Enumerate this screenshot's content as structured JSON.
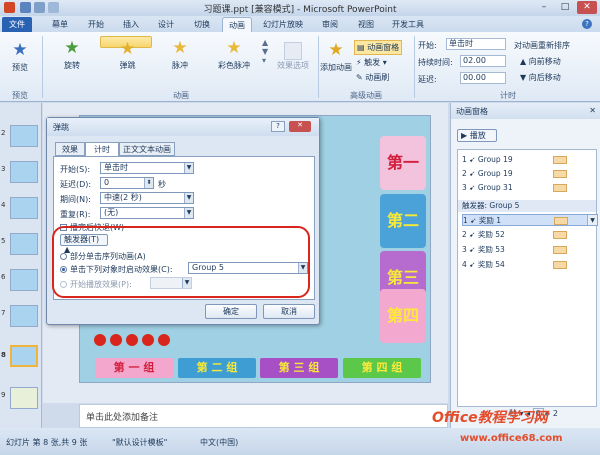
{
  "window": {
    "title": "习题课.ppt [兼容模式] - Microsoft PowerPoint"
  },
  "tabs": [
    "文件",
    "幕单",
    "开始",
    "插入",
    "设计",
    "切换",
    "动画",
    "幻灯片放映",
    "审阅",
    "视图",
    "开发工具"
  ],
  "ribbon": {
    "preview": "预览",
    "preview_group": "预览",
    "effects": [
      "旋转",
      "弹跳",
      "脉冲",
      "彩色脉冲"
    ],
    "effect_options": "效果选项",
    "anim_group": "动画",
    "add_anim": "添加动画",
    "anim_pane": "动画窗格",
    "trigger": "触发",
    "anim_brush": "动画刷",
    "adv_group": "高级动画",
    "start_label": "开始:",
    "start_value": "单击时",
    "duration_label": "持续时间:",
    "duration_value": "02.00",
    "delay_label": "延迟:",
    "delay_value": "00.00",
    "reorder": "对动画重新排序",
    "forward": "向前移动",
    "backward": "向后移动",
    "timing_group": "计时"
  },
  "slides": {
    "numbers": [
      "2",
      "3",
      "4",
      "5",
      "6",
      "7",
      "8",
      "9"
    ],
    "active": "8"
  },
  "slide": {
    "banners": [
      "第一关",
      "第二关",
      "第三关",
      "第四关"
    ],
    "groups": [
      "第 一 组",
      "第 二 组",
      "第 三 组",
      "第 四 组"
    ]
  },
  "notes": "单击此处添加备注",
  "anim_pane": {
    "title": "动画窗格",
    "play": "播放",
    "items": [
      {
        "n": "1",
        "name": "Group 19"
      },
      {
        "n": "2",
        "name": "Group 19"
      },
      {
        "n": "3",
        "name": "Group 31"
      }
    ],
    "trigger_label": "触发器: Group 5",
    "trigger_items": [
      {
        "n": "1",
        "name": "奖励 1"
      },
      {
        "n": "2",
        "name": "奖励 52"
      },
      {
        "n": "3",
        "name": "奖励 53"
      },
      {
        "n": "4",
        "name": "奖励 54"
      }
    ],
    "seconds": "秒",
    "page_from": "0",
    "page_to": "2"
  },
  "dialog": {
    "title": "弹跳",
    "tabs": [
      "效果",
      "计时",
      "正文文本动画"
    ],
    "start_label": "开始(S):",
    "start_value": "单击时",
    "delay_label": "延迟(D):",
    "delay_value": "0",
    "delay_unit": "秒",
    "duration_label": "期间(N):",
    "duration_value": "中速(2 秒)",
    "repeat_label": "重复(R):",
    "repeat_value": "(无)",
    "rewind": "播完后快退(W)",
    "triggers_button": "触发器(T)",
    "opt1": "部分单击序列动画(A)",
    "opt2": "单击下列对象时启动效果(C):",
    "opt2_value": "Group 5",
    "opt3": "开始播放效果(P):",
    "ok": "确定",
    "cancel": "取消"
  },
  "status": {
    "slide_info": "幻灯片 第 8 张,共 9 张",
    "theme": "\"默认设计模板\"",
    "lang": "中文(中国)"
  },
  "watermark": {
    "line1": "Office教程学习网",
    "line2": "www.office68.com"
  }
}
